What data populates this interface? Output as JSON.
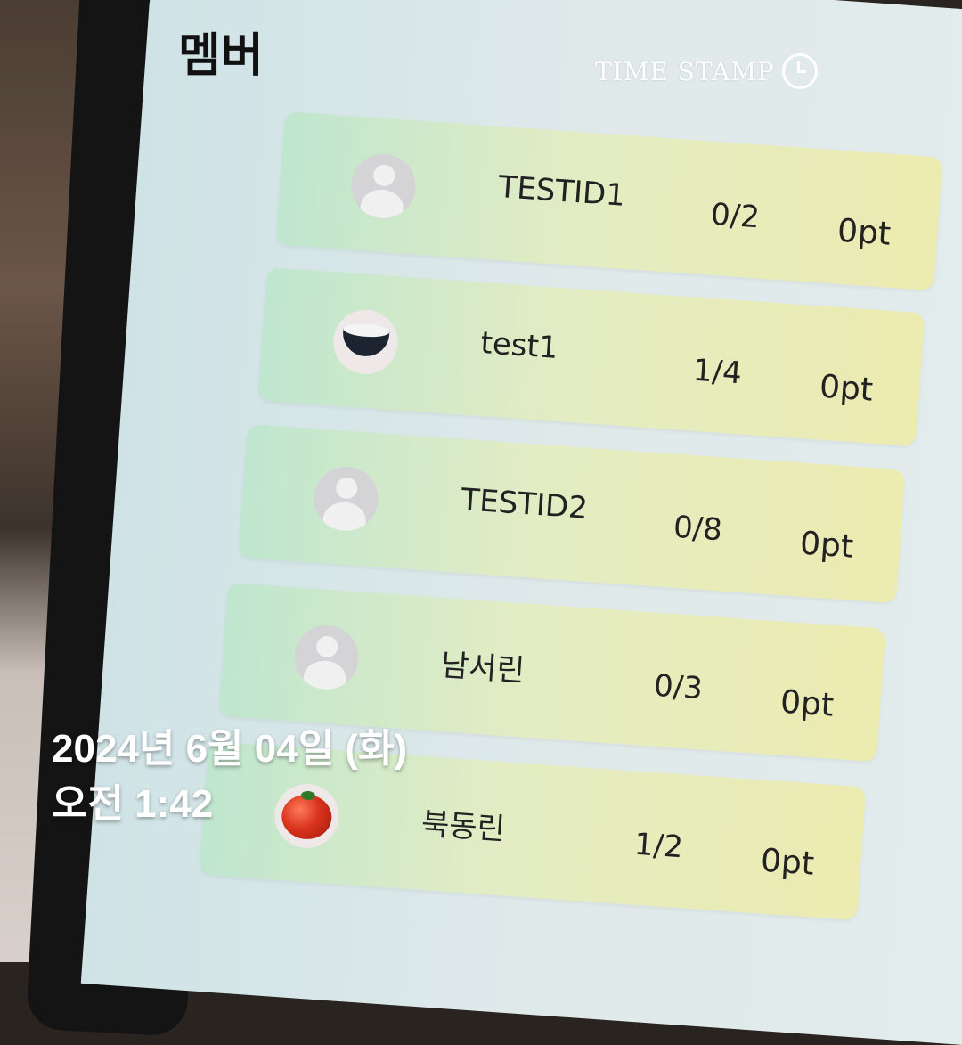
{
  "header": {
    "title": "멤버",
    "brand": "TIME STAMP"
  },
  "members": [
    {
      "name": "TESTID1",
      "ratio": "0/2",
      "points": "0pt",
      "avatar": "default-avatar-icon"
    },
    {
      "name": "test1",
      "ratio": "1/4",
      "points": "0pt",
      "avatar": "rice-bowl-image"
    },
    {
      "name": "TESTID2",
      "ratio": "0/8",
      "points": "0pt",
      "avatar": "default-avatar-icon"
    },
    {
      "name": "남서린",
      "ratio": "0/3",
      "points": "0pt",
      "avatar": "default-avatar-icon"
    },
    {
      "name": "북동린",
      "ratio": "1/2",
      "points": "0pt",
      "avatar": "tomato-image"
    }
  ],
  "timestamp": {
    "date": "2024년 6월 04일 (화)",
    "time": "오전 1:42"
  }
}
